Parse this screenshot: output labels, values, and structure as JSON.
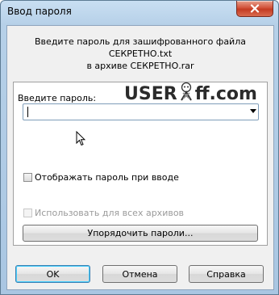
{
  "window": {
    "title": "Ввод пароля"
  },
  "header": {
    "line1": "Введите пароль для зашифрованного файла",
    "line2": "СЕКРЕТНО.txt",
    "line3": "в архиве СЕКРЕТНО.rar"
  },
  "password": {
    "label": "Введите пароль:",
    "value": ""
  },
  "watermark": {
    "left": "USER",
    "right": "ff.com"
  },
  "options": {
    "show_password_label": "Отображать пароль при вводе",
    "show_password_checked": false,
    "use_for_all_label": "Использовать для всех архивов",
    "use_for_all_checked": false,
    "use_for_all_enabled": false
  },
  "buttons": {
    "organize": "Упорядочить пароли...",
    "ok": "OK",
    "cancel": "Отмена",
    "help": "Справка"
  },
  "icons": {
    "close": "close-icon",
    "dropdown": "chevron-down-icon",
    "cursor": "mouse-pointer-icon"
  }
}
